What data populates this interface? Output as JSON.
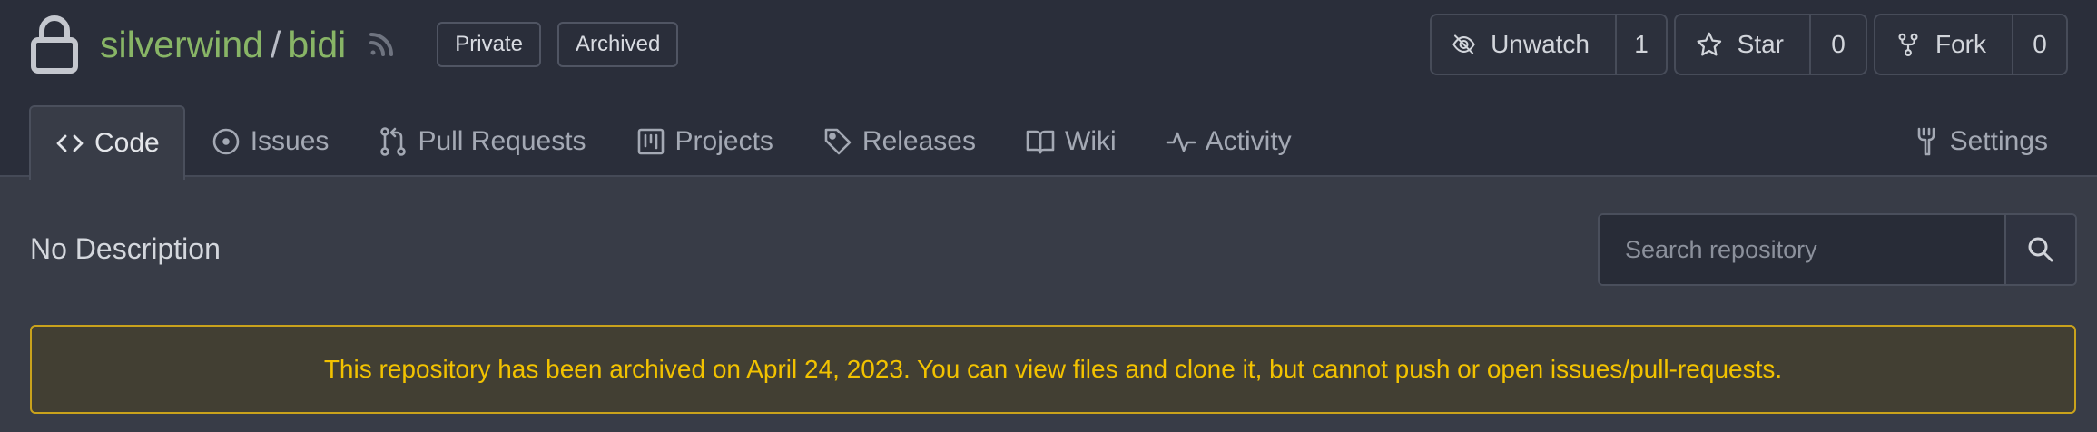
{
  "repo": {
    "owner": "silverwind",
    "separator": "/",
    "name": "bidi",
    "badges": [
      "Private",
      "Archived"
    ]
  },
  "actions": {
    "watch": {
      "label": "Unwatch",
      "count": "1",
      "icon": "eye-slash-icon"
    },
    "star": {
      "label": "Star",
      "count": "0",
      "icon": "star-icon"
    },
    "fork": {
      "label": "Fork",
      "count": "0",
      "icon": "fork-icon"
    }
  },
  "tabs": [
    {
      "label": "Code",
      "icon": "code-icon",
      "active": true
    },
    {
      "label": "Issues",
      "icon": "issue-icon"
    },
    {
      "label": "Pull Requests",
      "icon": "pull-request-icon"
    },
    {
      "label": "Projects",
      "icon": "project-icon"
    },
    {
      "label": "Releases",
      "icon": "tag-icon"
    },
    {
      "label": "Wiki",
      "icon": "book-icon"
    },
    {
      "label": "Activity",
      "icon": "pulse-icon"
    }
  ],
  "settings": {
    "label": "Settings",
    "icon": "tools-icon"
  },
  "description": "No Description",
  "search": {
    "placeholder": "Search repository"
  },
  "banner": {
    "text": "This repository has been archived on April 24, 2023. You can view files and clone it, but cannot push or open issues/pull-requests."
  },
  "colors": {
    "header_bg": "#2a2e3a",
    "body_bg": "#383c47",
    "repo_link": "#88b566",
    "banner_border": "#c9a21c",
    "banner_text": "#f2c200"
  }
}
